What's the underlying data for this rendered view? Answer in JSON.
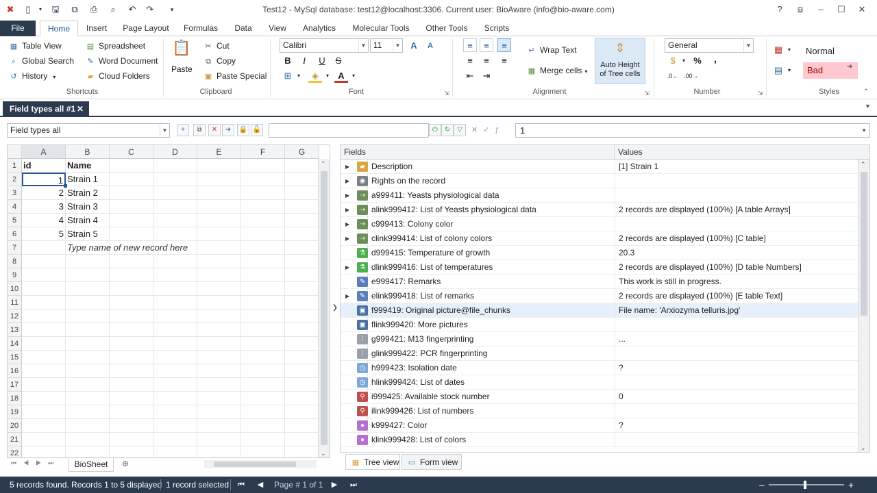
{
  "window": {
    "title": "Test12 - MySql database: test12@localhost:3306. Current user: BioAware (info@bio-aware.com)"
  },
  "ribbon_tabs": [
    {
      "label": "File"
    },
    {
      "label": "Home"
    },
    {
      "label": "Insert"
    },
    {
      "label": "Page Layout"
    },
    {
      "label": "Formulas"
    },
    {
      "label": "Data"
    },
    {
      "label": "View"
    },
    {
      "label": "Analytics"
    },
    {
      "label": "Molecular Tools"
    },
    {
      "label": "Other Tools"
    },
    {
      "label": "Scripts"
    }
  ],
  "shortcuts": {
    "group_label": "Shortcuts",
    "table_view": "Table View",
    "global_search": "Global Search",
    "history": "History",
    "spreadsheet": "Spreadsheet",
    "word_document": "Word Document",
    "cloud_folders": "Cloud Folders"
  },
  "clipboard": {
    "group_label": "Clipboard",
    "paste": "Paste",
    "cut": "Cut",
    "copy": "Copy",
    "paste_special": "Paste Special"
  },
  "font": {
    "group_label": "Font",
    "family": "Calibri",
    "size": "11"
  },
  "alignment": {
    "group_label": "Alignment",
    "wrap_text": "Wrap Text",
    "merge_cells": "Merge cells",
    "auto_height_line1": "Auto Height",
    "auto_height_line2": "of Tree cells"
  },
  "number": {
    "group_label": "Number",
    "format": "General",
    "percent": "%",
    "comma": ","
  },
  "styles": {
    "group_label": "Styles",
    "normal": "Normal",
    "bad": "Bad"
  },
  "doc_tab": {
    "label": "Field types all #1"
  },
  "toolbar": {
    "table_select": "Field types all",
    "search_value": "",
    "formula_value": "1"
  },
  "sheet": {
    "columns": [
      "A",
      "B",
      "C",
      "D",
      "E",
      "F",
      "G"
    ],
    "rows": [
      "1",
      "2",
      "3",
      "4",
      "5",
      "6",
      "7",
      "8",
      "9",
      "10",
      "11",
      "12",
      "13",
      "14",
      "15",
      "16",
      "17",
      "18",
      "19",
      "20",
      "21",
      "22"
    ],
    "header": {
      "id": "id",
      "name": "Name"
    },
    "records": [
      {
        "id": "1",
        "name": "Strain 1"
      },
      {
        "id": "2",
        "name": "Strain 2"
      },
      {
        "id": "3",
        "name": "Strain 3"
      },
      {
        "id": "4",
        "name": "Strain 4"
      },
      {
        "id": "5",
        "name": "Strain 5"
      }
    ],
    "new_record_hint": "Type name of new record here",
    "sheet_tab": "BioSheet"
  },
  "tree": {
    "col_fields": "Fields",
    "col_values": "Values",
    "rows": [
      {
        "field": "Description",
        "value": "[1] Strain 1",
        "expandable": true,
        "icon": "folder-icon",
        "color": "#d9a441"
      },
      {
        "field": "Rights on the record",
        "value": "",
        "expandable": true,
        "icon": "eye-icon",
        "color": "#7a7f87"
      },
      {
        "field": "a999411: Yeasts physiological data",
        "value": "",
        "expandable": true,
        "icon": "link-icon",
        "color": "#6b8e5a"
      },
      {
        "field": "alink999412: List of Yeasts physiological data",
        "value": "2 records are displayed (100%) [A table Arrays]",
        "expandable": true,
        "icon": "link-icon",
        "color": "#6b8e5a"
      },
      {
        "field": "c999413: Colony color",
        "value": "",
        "expandable": true,
        "icon": "link-icon",
        "color": "#6b8e5a"
      },
      {
        "field": "clink999414: List of colony colors",
        "value": "2 records are displayed (100%) [C table]",
        "expandable": true,
        "icon": "link-icon",
        "color": "#6b8e5a"
      },
      {
        "field": "d999415: Temperature of growth",
        "value": "20.3",
        "expandable": false,
        "icon": "flask-icon",
        "color": "#4caf50"
      },
      {
        "field": "dlink999416: List of temperatures",
        "value": "2 records are displayed (100%) [D table Numbers]",
        "expandable": true,
        "icon": "flask-icon",
        "color": "#4caf50"
      },
      {
        "field": "e999417: Remarks",
        "value": "This work is still in progress.",
        "expandable": false,
        "icon": "note-icon",
        "color": "#5b7fb8"
      },
      {
        "field": "elink999418: List of remarks",
        "value": "2 records are displayed (100%) [E table Text]",
        "expandable": true,
        "icon": "note-icon",
        "color": "#5b7fb8"
      },
      {
        "field": "f999419: Original picture@file_chunks",
        "value": "File name: 'Arxiozyma telluris.jpg'",
        "expandable": false,
        "icon": "picture-icon",
        "color": "#4a6fa5"
      },
      {
        "field": "flink999420: More pictures",
        "value": "",
        "expandable": false,
        "icon": "picture-icon",
        "color": "#4a6fa5"
      },
      {
        "field": "g999421: M13 fingerprinting",
        "value": "...",
        "expandable": false,
        "icon": "dots-icon",
        "color": "#9aa0a8"
      },
      {
        "field": "glink999422: PCR fingerprinting",
        "value": "",
        "expandable": false,
        "icon": "dots-icon",
        "color": "#9aa0a8"
      },
      {
        "field": "h999423: Isolation date",
        "value": "?",
        "expandable": false,
        "icon": "clock-icon",
        "color": "#7fa7d6"
      },
      {
        "field": "hlink999424: List of dates",
        "value": "",
        "expandable": false,
        "icon": "clock-icon",
        "color": "#7fa7d6"
      },
      {
        "field": "i999425: Available stock number",
        "value": "0",
        "expandable": false,
        "icon": "pin-icon",
        "color": "#c0504d"
      },
      {
        "field": "ilink999426: List of numbers",
        "value": "",
        "expandable": false,
        "icon": "pin-icon",
        "color": "#c0504d"
      },
      {
        "field": "k999427: Color",
        "value": "?",
        "expandable": false,
        "icon": "color-wheel-icon",
        "color": "#b76fd1"
      },
      {
        "field": "klink999428: List of colors",
        "value": "",
        "expandable": false,
        "icon": "color-wheel-icon",
        "color": "#b76fd1"
      }
    ],
    "tab_tree": "Tree view",
    "tab_form": "Form view"
  },
  "status": {
    "records_found": "5 records found. Records 1 to 5 displayed",
    "selected": "1 record selected",
    "page": "Page # 1 of 1"
  },
  "colors": {
    "accent_dark": "#2b3a4f",
    "active_tab_text": "#1f4e8c",
    "bad_bg": "#ffc7ce",
    "bad_text": "#9c0006",
    "selected_row": "#e5f0fb"
  }
}
